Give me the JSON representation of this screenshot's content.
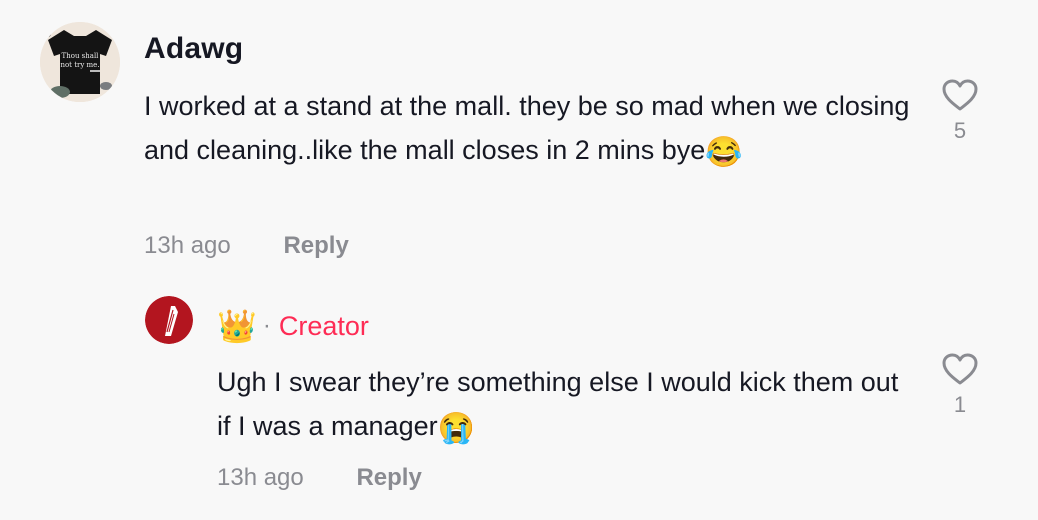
{
  "comment": {
    "username": "Adawg",
    "text": "I worked at a stand at the mall. they be so mad when we closing and cleaning..like the mall closes in 2 mins bye",
    "emoji": "😂",
    "time": "13h ago",
    "reply_label": "Reply",
    "like_count": "5",
    "avatar_shirt_text": [
      "Thou shall",
      "not try me."
    ]
  },
  "reply": {
    "badge_emoji": "👑",
    "separator": "·",
    "creator_label": "Creator",
    "text": "Ugh I swear they’re something else I would kick them out if I was a manager",
    "emoji": "😭",
    "time": "13h ago",
    "reply_label": "Reply",
    "like_count": "1"
  },
  "colors": {
    "background": "#f8f8f8",
    "creator": "#fe2c55",
    "secondary_text": "#8a8b91",
    "primary_text": "#161823"
  }
}
